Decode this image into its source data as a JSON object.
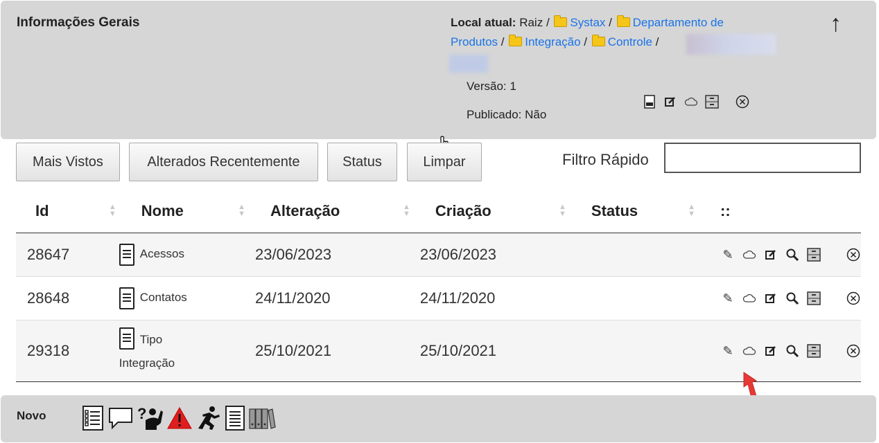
{
  "header": {
    "title": "Informações Gerais",
    "location_label": "Local atual:",
    "root": "Raiz",
    "sep": "/",
    "crumbs": [
      "Systax",
      "Departamento de Produtos",
      "Integração",
      "Controle"
    ],
    "version": "Versão: 1",
    "published": "Publicado: Não",
    "up_icon": "↑"
  },
  "toolbar": {
    "buttons": [
      "Mais Vistos",
      "Alterados Recentemente",
      "Status",
      "Limpar"
    ],
    "filter_label": "Filtro Rápido",
    "filter_value": ""
  },
  "table": {
    "columns": [
      "Id",
      "Nome",
      "Alteração",
      "Criação",
      "Status",
      "::"
    ],
    "rows": [
      {
        "id": "28647",
        "name": "Acessos",
        "altered": "23/06/2023",
        "created": "23/06/2023",
        "status": ""
      },
      {
        "id": "28648",
        "name": "Contatos",
        "altered": "24/11/2020",
        "created": "24/11/2020",
        "status": ""
      },
      {
        "id": "29318",
        "name": "Tipo Integração",
        "altered": "25/10/2021",
        "created": "25/10/2021",
        "status": ""
      }
    ]
  },
  "footer": {
    "new_label": "Novo"
  },
  "colors": {
    "panel": "#d6d6d6",
    "link": "#1a73e8",
    "arrow": "#e53935"
  }
}
